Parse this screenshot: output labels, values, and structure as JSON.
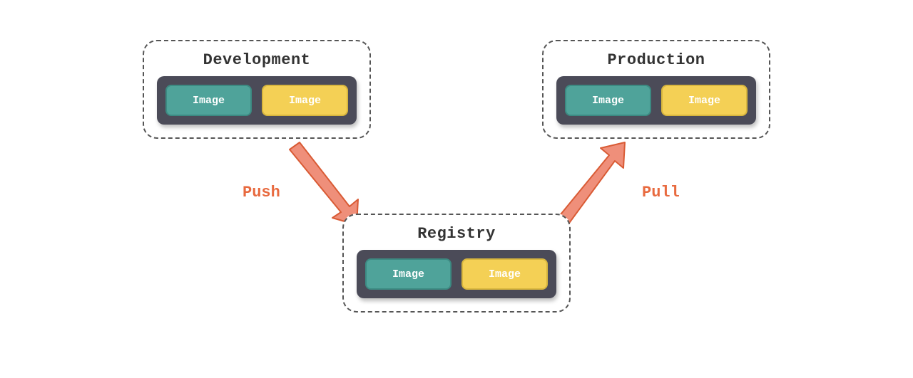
{
  "environments": {
    "development": {
      "title": "Development",
      "images": [
        "Image",
        "Image"
      ]
    },
    "production": {
      "title": "Production",
      "images": [
        "Image",
        "Image"
      ]
    },
    "registry": {
      "title": "Registry",
      "images": [
        "Image",
        "Image"
      ]
    }
  },
  "flows": {
    "push": {
      "label": "Push",
      "from": "development",
      "to": "registry"
    },
    "pull": {
      "label": "Pull",
      "from": "registry",
      "to": "production"
    }
  },
  "colors": {
    "chip_teal": "#4fa39a",
    "chip_yellow": "#f4d055",
    "tray": "#4b4b58",
    "arrow_fill": "#ef8f7a",
    "arrow_stroke": "#d95b35",
    "label": "#e86a3f"
  }
}
